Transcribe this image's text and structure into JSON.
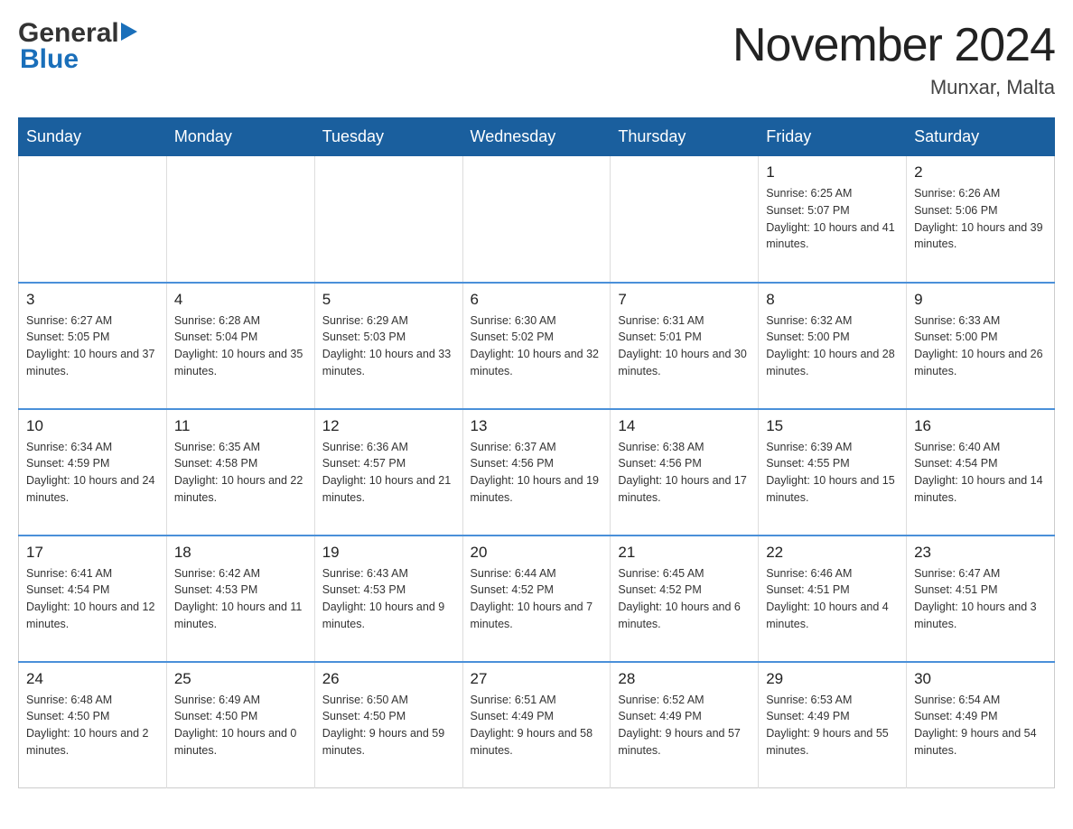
{
  "header": {
    "logo_general": "General",
    "logo_blue": "Blue",
    "title": "November 2024",
    "subtitle": "Munxar, Malta"
  },
  "days_of_week": [
    "Sunday",
    "Monday",
    "Tuesday",
    "Wednesday",
    "Thursday",
    "Friday",
    "Saturday"
  ],
  "weeks": [
    [
      {
        "day": "",
        "info": ""
      },
      {
        "day": "",
        "info": ""
      },
      {
        "day": "",
        "info": ""
      },
      {
        "day": "",
        "info": ""
      },
      {
        "day": "",
        "info": ""
      },
      {
        "day": "1",
        "info": "Sunrise: 6:25 AM\nSunset: 5:07 PM\nDaylight: 10 hours and 41 minutes."
      },
      {
        "day": "2",
        "info": "Sunrise: 6:26 AM\nSunset: 5:06 PM\nDaylight: 10 hours and 39 minutes."
      }
    ],
    [
      {
        "day": "3",
        "info": "Sunrise: 6:27 AM\nSunset: 5:05 PM\nDaylight: 10 hours and 37 minutes."
      },
      {
        "day": "4",
        "info": "Sunrise: 6:28 AM\nSunset: 5:04 PM\nDaylight: 10 hours and 35 minutes."
      },
      {
        "day": "5",
        "info": "Sunrise: 6:29 AM\nSunset: 5:03 PM\nDaylight: 10 hours and 33 minutes."
      },
      {
        "day": "6",
        "info": "Sunrise: 6:30 AM\nSunset: 5:02 PM\nDaylight: 10 hours and 32 minutes."
      },
      {
        "day": "7",
        "info": "Sunrise: 6:31 AM\nSunset: 5:01 PM\nDaylight: 10 hours and 30 minutes."
      },
      {
        "day": "8",
        "info": "Sunrise: 6:32 AM\nSunset: 5:00 PM\nDaylight: 10 hours and 28 minutes."
      },
      {
        "day": "9",
        "info": "Sunrise: 6:33 AM\nSunset: 5:00 PM\nDaylight: 10 hours and 26 minutes."
      }
    ],
    [
      {
        "day": "10",
        "info": "Sunrise: 6:34 AM\nSunset: 4:59 PM\nDaylight: 10 hours and 24 minutes."
      },
      {
        "day": "11",
        "info": "Sunrise: 6:35 AM\nSunset: 4:58 PM\nDaylight: 10 hours and 22 minutes."
      },
      {
        "day": "12",
        "info": "Sunrise: 6:36 AM\nSunset: 4:57 PM\nDaylight: 10 hours and 21 minutes."
      },
      {
        "day": "13",
        "info": "Sunrise: 6:37 AM\nSunset: 4:56 PM\nDaylight: 10 hours and 19 minutes."
      },
      {
        "day": "14",
        "info": "Sunrise: 6:38 AM\nSunset: 4:56 PM\nDaylight: 10 hours and 17 minutes."
      },
      {
        "day": "15",
        "info": "Sunrise: 6:39 AM\nSunset: 4:55 PM\nDaylight: 10 hours and 15 minutes."
      },
      {
        "day": "16",
        "info": "Sunrise: 6:40 AM\nSunset: 4:54 PM\nDaylight: 10 hours and 14 minutes."
      }
    ],
    [
      {
        "day": "17",
        "info": "Sunrise: 6:41 AM\nSunset: 4:54 PM\nDaylight: 10 hours and 12 minutes."
      },
      {
        "day": "18",
        "info": "Sunrise: 6:42 AM\nSunset: 4:53 PM\nDaylight: 10 hours and 11 minutes."
      },
      {
        "day": "19",
        "info": "Sunrise: 6:43 AM\nSunset: 4:53 PM\nDaylight: 10 hours and 9 minutes."
      },
      {
        "day": "20",
        "info": "Sunrise: 6:44 AM\nSunset: 4:52 PM\nDaylight: 10 hours and 7 minutes."
      },
      {
        "day": "21",
        "info": "Sunrise: 6:45 AM\nSunset: 4:52 PM\nDaylight: 10 hours and 6 minutes."
      },
      {
        "day": "22",
        "info": "Sunrise: 6:46 AM\nSunset: 4:51 PM\nDaylight: 10 hours and 4 minutes."
      },
      {
        "day": "23",
        "info": "Sunrise: 6:47 AM\nSunset: 4:51 PM\nDaylight: 10 hours and 3 minutes."
      }
    ],
    [
      {
        "day": "24",
        "info": "Sunrise: 6:48 AM\nSunset: 4:50 PM\nDaylight: 10 hours and 2 minutes."
      },
      {
        "day": "25",
        "info": "Sunrise: 6:49 AM\nSunset: 4:50 PM\nDaylight: 10 hours and 0 minutes."
      },
      {
        "day": "26",
        "info": "Sunrise: 6:50 AM\nSunset: 4:50 PM\nDaylight: 9 hours and 59 minutes."
      },
      {
        "day": "27",
        "info": "Sunrise: 6:51 AM\nSunset: 4:49 PM\nDaylight: 9 hours and 58 minutes."
      },
      {
        "day": "28",
        "info": "Sunrise: 6:52 AM\nSunset: 4:49 PM\nDaylight: 9 hours and 57 minutes."
      },
      {
        "day": "29",
        "info": "Sunrise: 6:53 AM\nSunset: 4:49 PM\nDaylight: 9 hours and 55 minutes."
      },
      {
        "day": "30",
        "info": "Sunrise: 6:54 AM\nSunset: 4:49 PM\nDaylight: 9 hours and 54 minutes."
      }
    ]
  ]
}
